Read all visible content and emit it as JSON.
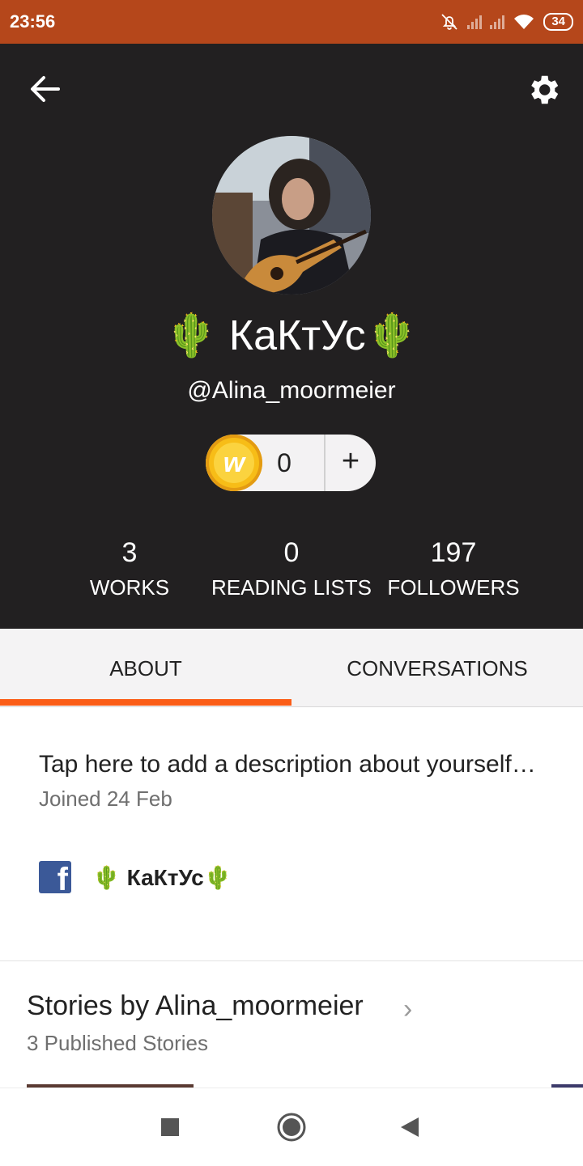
{
  "status_bar": {
    "time": "23:56",
    "battery": "34",
    "icons": [
      "bell-off-icon",
      "signal-icon",
      "signal-icon",
      "wifi-icon",
      "battery-icon"
    ]
  },
  "header": {
    "back_icon": "arrow-left-icon",
    "settings_icon": "gear-icon",
    "display_name": "🌵 КаКтУс🌵",
    "username": "@Alina_moormeier",
    "coins": {
      "count": "0",
      "plus": "+"
    },
    "stats": [
      {
        "value": "3",
        "label": "WORKS"
      },
      {
        "value": "0",
        "label": "READING LISTS"
      },
      {
        "value": "197",
        "label": "FOLLOWERS"
      }
    ]
  },
  "tabs": [
    {
      "label": "ABOUT",
      "active": true
    },
    {
      "label": "CONVERSATIONS",
      "active": false
    }
  ],
  "about": {
    "description": "Tap here to add a description about yourself…",
    "joined": "Joined 24 Feb",
    "facebook_name": "🌵 КаКтУс🌵"
  },
  "stories": {
    "title": "Stories by Alina_moormeier",
    "count": "3 Published Stories"
  },
  "nav_bar": {
    "icons": [
      "recents-square-icon",
      "home-circle-icon",
      "back-triangle-icon"
    ]
  },
  "colors": {
    "status_bar": "#b5471b",
    "header_bg": "#222021",
    "accent": "#fb5d17",
    "coin": "#f7bd17",
    "facebook": "#3b5998"
  }
}
